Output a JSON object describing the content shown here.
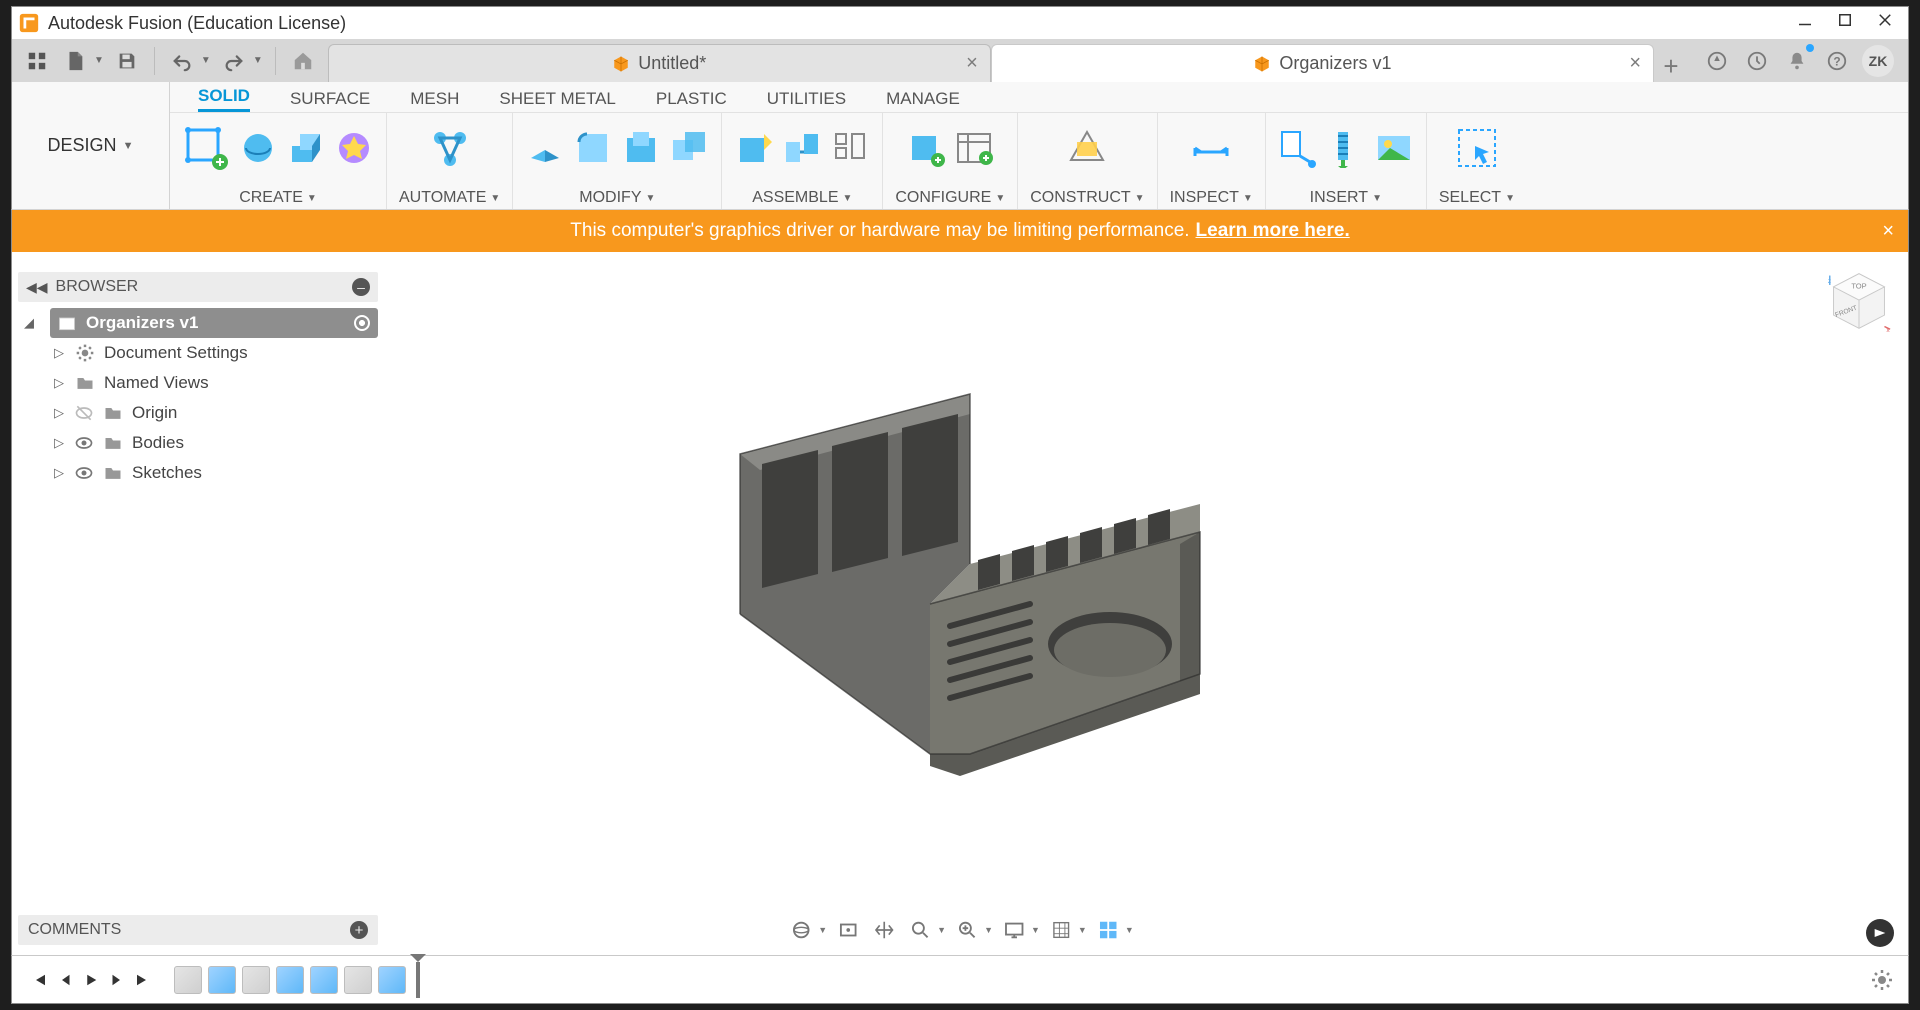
{
  "app": {
    "title": "Autodesk Fusion (Education License)"
  },
  "user": {
    "initials": "ZK"
  },
  "documents": [
    {
      "label": "Untitled*",
      "active": false
    },
    {
      "label": "Organizers v1",
      "active": true
    }
  ],
  "workspace": "DESIGN",
  "ribbon_tabs": [
    "SOLID",
    "SURFACE",
    "MESH",
    "SHEET METAL",
    "PLASTIC",
    "UTILITIES",
    "MANAGE"
  ],
  "ribbon_selected": "SOLID",
  "ribbon_groups": [
    "CREATE",
    "AUTOMATE",
    "MODIFY",
    "ASSEMBLE",
    "CONFIGURE",
    "CONSTRUCT",
    "INSPECT",
    "INSERT",
    "SELECT"
  ],
  "warning": {
    "text": "This computer's graphics driver or hardware may be limiting performance.",
    "link": "Learn more here."
  },
  "browser": {
    "title": "BROWSER",
    "root": "Organizers v1",
    "items": [
      {
        "label": "Document Settings",
        "icon": "gear"
      },
      {
        "label": "Named Views",
        "icon": "folder"
      },
      {
        "label": "Origin",
        "icon": "folder",
        "hidden": true
      },
      {
        "label": "Bodies",
        "icon": "folder"
      },
      {
        "label": "Sketches",
        "icon": "folder"
      }
    ]
  },
  "comments_title": "COMMENTS",
  "viewcube": {
    "top": "TOP",
    "front": "FRONT"
  }
}
